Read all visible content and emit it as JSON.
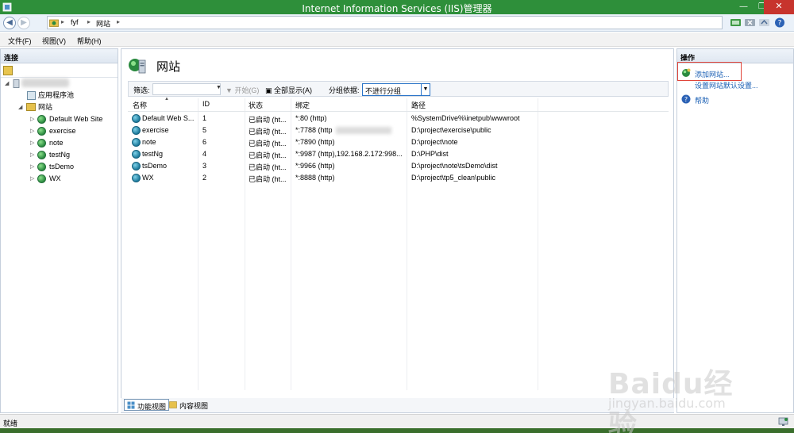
{
  "window": {
    "title": "Internet Information Services (IIS)管理器",
    "minimize": "—",
    "restore": "❐",
    "close": "✕"
  },
  "address": {
    "breadcrumbs": [
      "fyf",
      "网站"
    ],
    "sep": "▸",
    "back": "◀",
    "forward": "▶"
  },
  "menu": [
    "文件(F)",
    "视图(V)",
    "帮助(H)"
  ],
  "connections": {
    "header": "连接",
    "tree": {
      "app_pools": "应用程序池",
      "sites_label": "网站",
      "sites": [
        "Default Web Site",
        "exercise",
        "note",
        "testNg",
        "tsDemo",
        "WX"
      ]
    }
  },
  "main": {
    "title": "网站",
    "filter": {
      "label": "筛选:",
      "start": "开始(G)",
      "show_all": "全部显示(A)",
      "group_by": "分组依据:",
      "group_value": "不进行分组"
    },
    "columns": [
      "名称",
      "ID",
      "状态",
      "绑定",
      "路径"
    ],
    "rows": [
      {
        "name": "Default Web S...",
        "id": "1",
        "status": "已启动 (ht...",
        "binding": "*:80 (http)",
        "path": "%SystemDrive%\\inetpub\\wwwroot"
      },
      {
        "name": "exercise",
        "id": "5",
        "status": "已启动 (ht...",
        "binding": "*:7788 (http",
        "path": "D:\\project\\exercise\\public"
      },
      {
        "name": "note",
        "id": "6",
        "status": "已启动 (ht...",
        "binding": "*:7890 (http)",
        "path": "D:\\project\\note"
      },
      {
        "name": "testNg",
        "id": "4",
        "status": "已启动 (ht...",
        "binding": "*:9987 (http),192.168.2.172:998...",
        "path": "D:\\PHP\\dist"
      },
      {
        "name": "tsDemo",
        "id": "3",
        "status": "已启动 (ht...",
        "binding": "*:9966 (http)",
        "path": "D:\\project\\note\\tsDemo\\dist"
      },
      {
        "name": "WX",
        "id": "2",
        "status": "已启动 (ht...",
        "binding": "*:8888 (http)",
        "path": "D:\\project\\tp5_clean\\public"
      }
    ],
    "views": {
      "features": "功能视图",
      "content": "内容视图"
    }
  },
  "actions": {
    "header": "操作",
    "add_site": "添加网站...",
    "set_defaults": "设置网站默认设置...",
    "help": "帮助"
  },
  "status": {
    "text": "就绪"
  },
  "watermark": {
    "main": "Baidu经验",
    "sub": "jingyan.baidu.com"
  }
}
